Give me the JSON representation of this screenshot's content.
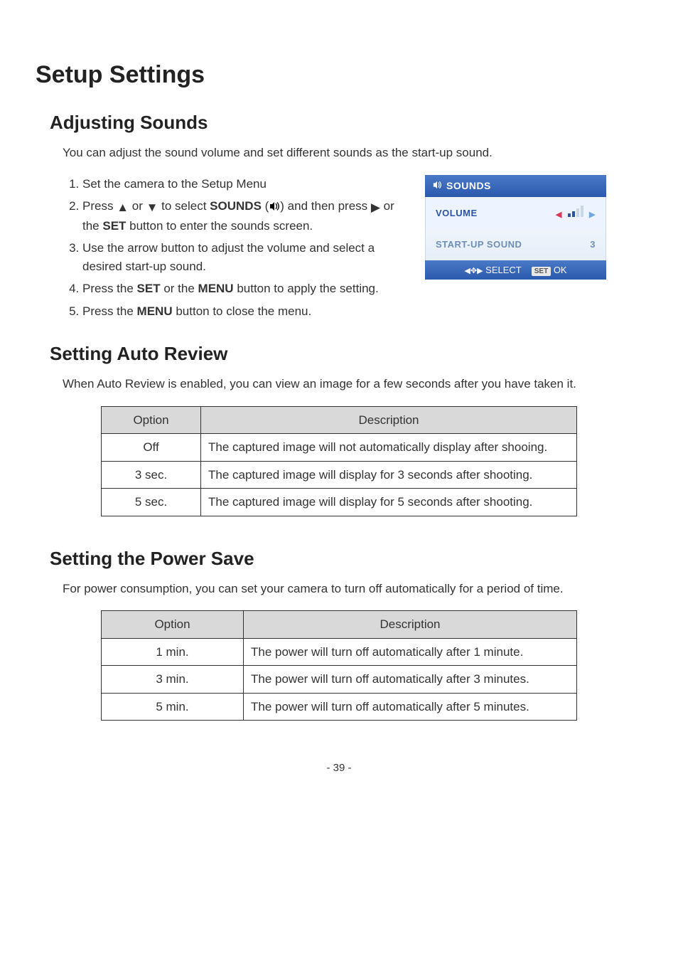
{
  "page_number": "- 39 -",
  "title": "Setup Settings",
  "section_sounds": {
    "heading": "Adjusting Sounds",
    "intro": "You can adjust the sound volume and set different sounds as the start-up sound.",
    "steps": {
      "s1": "Set the camera to the Setup Menu",
      "s2a": "Press ",
      "s2b": " or ",
      "s2c": " to select ",
      "s2d": "SOUNDS",
      "s2e": " (",
      "s2f": ") and then press ",
      "s2g": " or the ",
      "s2h": "SET",
      "s2i": " button to enter the sounds screen.",
      "s3": "Use the arrow button to adjust the volume and select a desired start-up sound.",
      "s4a": "Press the ",
      "s4b": "SET",
      "s4c": " or the ",
      "s4d": "MENU",
      "s4e": " button to apply the setting.",
      "s5a": "Press the ",
      "s5b": "MENU",
      "s5c": " button to close the menu."
    }
  },
  "screenshot": {
    "title": "SOUNDS",
    "row1_label": "VOLUME",
    "row2_label": "START-UP SOUND",
    "row2_value": "3",
    "btm_select": "SELECT",
    "btm_set": "SET",
    "btm_ok": "OK",
    "volume_bars": {
      "total": 4,
      "filled": 2
    }
  },
  "section_autoreview": {
    "heading": "Setting Auto Review",
    "intro": "When Auto Review is enabled, you can view an image for a few seconds after you have taken it.",
    "th_option": "Option",
    "th_desc": "Description",
    "rows": [
      {
        "option": "Off",
        "desc": "The captured image will not automatically display after shooing."
      },
      {
        "option": "3 sec.",
        "desc": "The captured image will display for 3 seconds after shooting."
      },
      {
        "option": "5 sec.",
        "desc": "The captured image will display for 5 seconds after shooting."
      }
    ]
  },
  "section_power": {
    "heading": "Setting the Power Save",
    "intro": "For power consumption, you can set your camera to turn off automatically for a period of time.",
    "th_option": "Option",
    "th_desc": "Description",
    "rows": [
      {
        "option": "1 min.",
        "desc": "The power will turn off automatically after 1 minute."
      },
      {
        "option": "3 min.",
        "desc": "The power will turn off automatically after 3 minutes."
      },
      {
        "option": "5 min.",
        "desc": "The power will turn off automatically after 5 minutes."
      }
    ]
  }
}
